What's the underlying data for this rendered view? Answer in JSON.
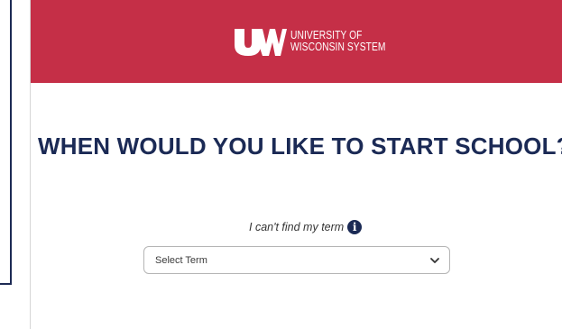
{
  "brand": {
    "logo_line1": "UNIVERSITY OF",
    "logo_line2": "WISCONSIN SYSTEM",
    "header_color": "#c52f47",
    "navy": "#1b2a55"
  },
  "main": {
    "title": "WHEN WOULD YOU LIKE TO START SCHOOL?",
    "help_link": "I can't find my term",
    "help_icon": "info-icon",
    "term_select": {
      "value": "Select Term",
      "icon": "chevron-down-icon"
    }
  }
}
